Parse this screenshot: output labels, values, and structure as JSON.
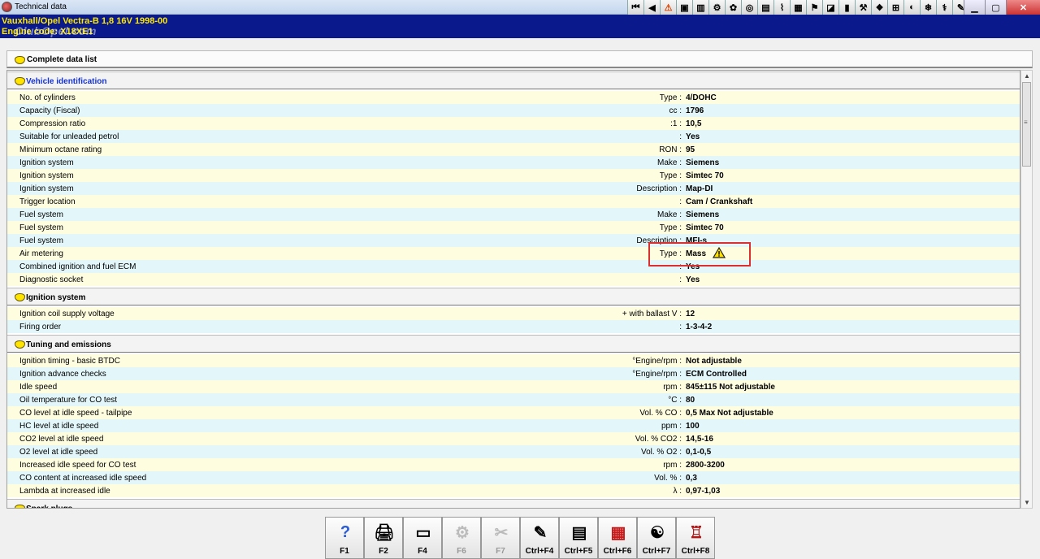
{
  "window": {
    "title": "Technical data",
    "vehicle_line1": "Vauxhall/Opel  Vectra-B  1,8 16V 1998-00",
    "vehicle_line2": "Engine code: X18XE1",
    "logo_text": "ClubOpel.com"
  },
  "toolbar_icons": [
    "first-record-icon",
    "prev-record-icon",
    "warning-icon",
    "car-icon",
    "chart-icon",
    "engine-icon",
    "gear-icon",
    "tyre-icon",
    "data-icon",
    "wiring-icon",
    "fuse-icon",
    "service-icon",
    "lubrication-icon",
    "battery-icon",
    "diagnostic-icon",
    "adjust-icon",
    "belt-icon",
    "brake-icon",
    "aircon-icon",
    "repair-icon",
    "notes-icon",
    "settings-icon"
  ],
  "list_bar": {
    "label": "Complete data list"
  },
  "sections": [
    {
      "title": "Vehicle identification",
      "rows": [
        {
          "name": "No. of cylinders",
          "unit": "Type :",
          "value": "4/DOHC"
        },
        {
          "name": "Capacity (Fiscal)",
          "unit": "cc :",
          "value": "1796"
        },
        {
          "name": "Compression ratio",
          "unit": ":1 :",
          "value": "10,5"
        },
        {
          "name": "Suitable for unleaded petrol",
          "unit": ":",
          "value": "Yes"
        },
        {
          "name": "Minimum octane rating",
          "unit": "RON :",
          "value": "95"
        },
        {
          "name": "Ignition system",
          "unit": "Make :",
          "value": "Siemens"
        },
        {
          "name": "Ignition system",
          "unit": "Type :",
          "value": "Simtec 70"
        },
        {
          "name": "Ignition system",
          "unit": "Description :",
          "value": "Map-DI"
        },
        {
          "name": "Trigger location",
          "unit": ":",
          "value": "Cam / Crankshaft"
        },
        {
          "name": "Fuel system",
          "unit": "Make :",
          "value": "Siemens"
        },
        {
          "name": "Fuel system",
          "unit": "Type :",
          "value": "Simtec 70"
        },
        {
          "name": "Fuel system",
          "unit": "Description :",
          "value": "MFI-s"
        },
        {
          "name": "Air metering",
          "unit": "Type :",
          "value": "Mass"
        },
        {
          "name": "Combined ignition and fuel ECM",
          "unit": ":",
          "value": "Yes"
        },
        {
          "name": "Diagnostic socket",
          "unit": ":",
          "value": "Yes"
        }
      ]
    },
    {
      "title": "Ignition system",
      "rows": [
        {
          "name": "Ignition coil supply voltage",
          "unit": "+ with ballast  V :",
          "value": "12"
        },
        {
          "name": "Firing order",
          "unit": ":",
          "value": "1-3-4-2"
        }
      ]
    },
    {
      "title": "Tuning and emissions",
      "rows": [
        {
          "name": "Ignition timing - basic  BTDC",
          "unit": "°Engine/rpm :",
          "value": "Not adjustable"
        },
        {
          "name": "Ignition advance checks",
          "unit": "°Engine/rpm :",
          "value": "ECM Controlled"
        },
        {
          "name": "Idle speed",
          "unit": "rpm :",
          "value": "845±115 Not adjustable"
        },
        {
          "name": "Oil temperature for CO test",
          "unit": "°C :",
          "value": "80"
        },
        {
          "name": "CO level at idle speed - tailpipe",
          "unit": "Vol. % CO :",
          "value": "0,5 Max Not adjustable"
        },
        {
          "name": "HC level at idle speed",
          "unit": "ppm :",
          "value": "100"
        },
        {
          "name": "CO2 level at idle speed",
          "unit": "Vol. % CO2 :",
          "value": "14,5-16"
        },
        {
          "name": "O2 level at idle speed",
          "unit": "Vol. % O2 :",
          "value": "0,1-0,5"
        },
        {
          "name": "Increased idle speed for CO test",
          "unit": "rpm :",
          "value": "2800-3200"
        },
        {
          "name": "CO content at increased idle speed",
          "unit": "Vol. % :",
          "value": "0,3"
        },
        {
          "name": "Lambda at increased idle",
          "unit": "λ :",
          "value": "0,97-1,03"
        }
      ]
    },
    {
      "title": "Spark plugs",
      "rows": []
    }
  ],
  "function_keys": [
    {
      "key": "F1",
      "icon": "help-icon",
      "glyph": "?",
      "enabled": true
    },
    {
      "key": "F2",
      "icon": "print-icon",
      "glyph": "🖨",
      "enabled": true
    },
    {
      "key": "F4",
      "icon": "window-icon",
      "glyph": "▭",
      "enabled": true
    },
    {
      "key": "F6",
      "icon": "adjust-grey-icon",
      "glyph": "⚙",
      "enabled": false
    },
    {
      "key": "F7",
      "icon": "tools-grey-icon",
      "glyph": "✂",
      "enabled": false
    },
    {
      "key": "Ctrl+F4",
      "icon": "notes-icon",
      "glyph": "✎",
      "enabled": true
    },
    {
      "key": "Ctrl+F5",
      "icon": "document-icon",
      "glyph": "▤",
      "enabled": true
    },
    {
      "key": "Ctrl+F6",
      "icon": "calendar-icon",
      "glyph": "▦",
      "enabled": true
    },
    {
      "key": "Ctrl+F7",
      "icon": "wrench-icon",
      "glyph": "☯",
      "enabled": true
    },
    {
      "key": "Ctrl+F8",
      "icon": "lift-icon",
      "glyph": "♖",
      "enabled": true
    }
  ]
}
